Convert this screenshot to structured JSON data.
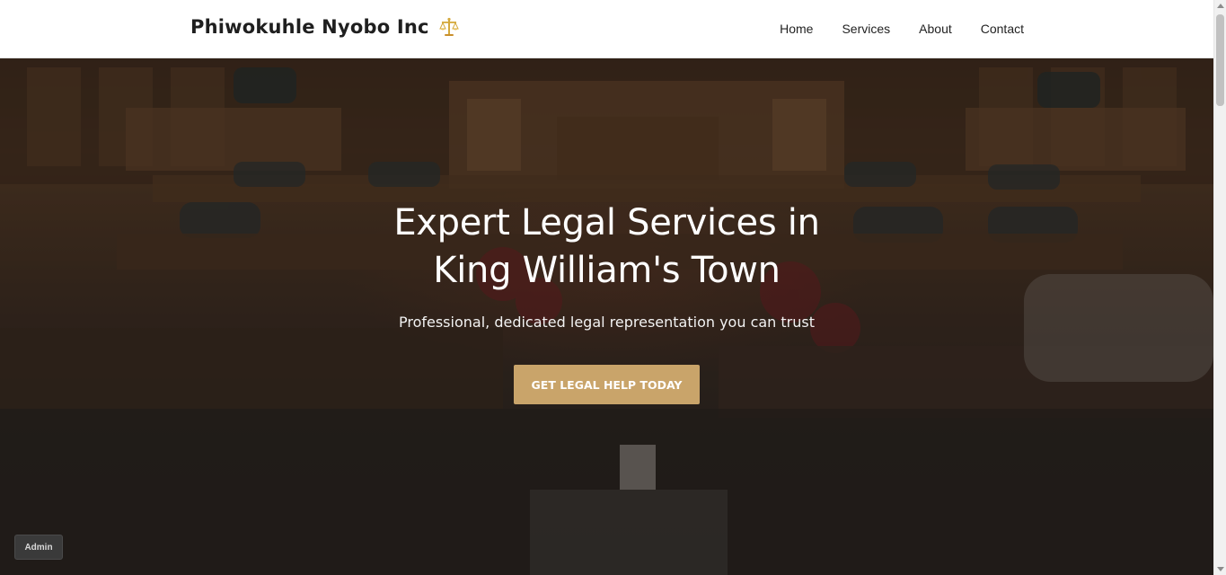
{
  "header": {
    "brand": "Phiwokuhle Nyobo Inc",
    "brand_icon": "scales-of-justice-icon",
    "nav": [
      {
        "label": "Home"
      },
      {
        "label": "Services"
      },
      {
        "label": "About"
      },
      {
        "label": "Contact"
      }
    ]
  },
  "hero": {
    "title_line1": "Expert Legal Services in",
    "title_line2": "King William's Town",
    "subtitle": "Professional, dedicated legal representation you can trust",
    "cta_label": "GET LEGAL HELP TODAY",
    "background": "courtroom-photo"
  },
  "admin_button": "Admin",
  "colors": {
    "accent": "#c9a46a",
    "header_bg": "#ffffff",
    "text_dark": "#1f1f1f"
  }
}
